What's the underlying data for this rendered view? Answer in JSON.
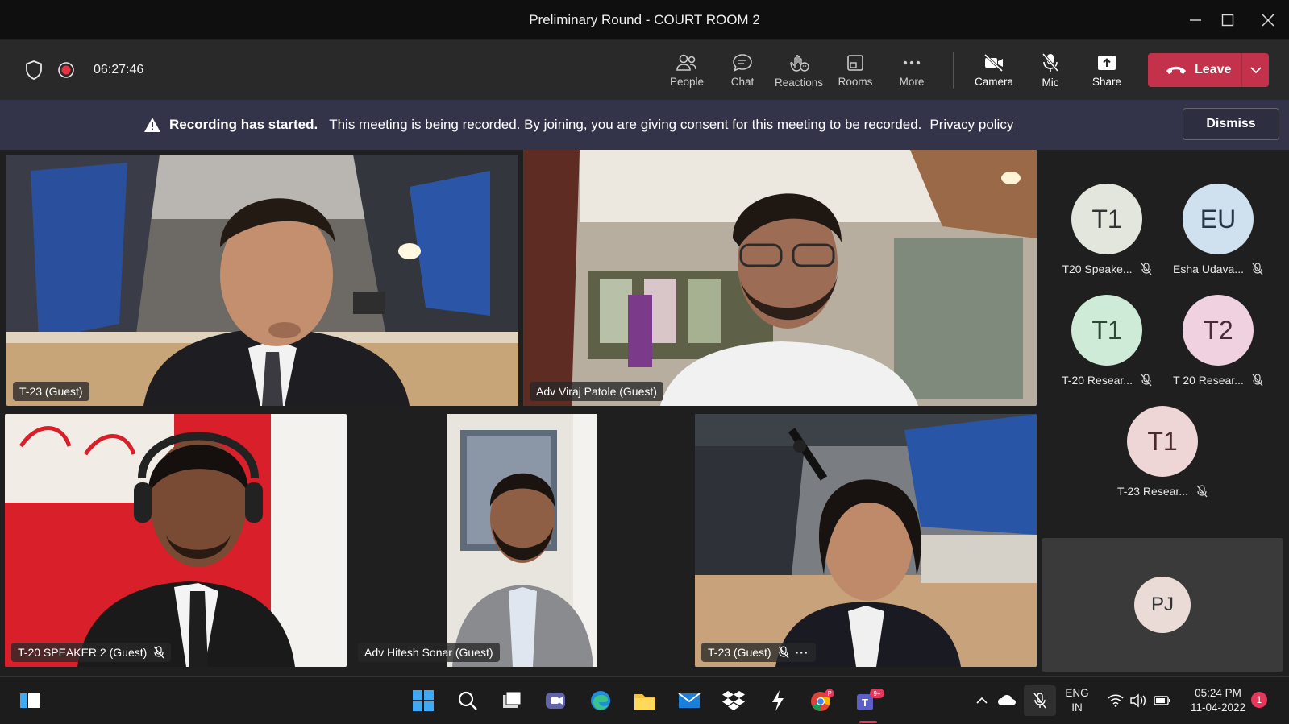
{
  "window": {
    "title": "Preliminary Round - COURT ROOM 2"
  },
  "toolbar": {
    "timer": "06:27:46",
    "buttons": {
      "people": "People",
      "chat": "Chat",
      "reactions": "Reactions",
      "rooms": "Rooms",
      "more": "More",
      "camera": "Camera",
      "mic": "Mic",
      "share": "Share"
    },
    "leave": "Leave"
  },
  "banner": {
    "headline": "Recording has started.",
    "message": "This meeting is being recorded. By joining, you are giving consent for this meeting to be recorded.",
    "link": "Privacy policy",
    "dismiss": "Dismiss"
  },
  "tiles": [
    {
      "name": "T-23 (Guest)",
      "muted": false,
      "active": true
    },
    {
      "name": "Adv Viraj Patole (Guest)",
      "muted": false
    },
    {
      "name": "T-20 SPEAKER 2 (Guest)",
      "muted": true
    },
    {
      "name": "Adv Hitesh Sonar (Guest)",
      "muted": false
    },
    {
      "name": "T-23 (Guest)",
      "muted": true,
      "more": "···"
    }
  ],
  "roster": [
    {
      "initials": "T1",
      "name": "T20 Speake...",
      "color": "#e2e6dc"
    },
    {
      "initials": "EU",
      "name": "Esha Udava...",
      "color": "#cfe0ef"
    },
    {
      "initials": "T1",
      "name": "T-20 Resear...",
      "color": "#cdebd7"
    },
    {
      "initials": "T2",
      "name": "T 20 Resear...",
      "color": "#efd1df"
    },
    {
      "initials": "T1",
      "name": "T-23 Resear...",
      "color": "#efd6d6"
    }
  ],
  "pj": {
    "initials": "PJ"
  },
  "taskbar": {
    "lang_top": "ENG",
    "lang_bottom": "IN",
    "time": "05:24 PM",
    "date": "11-04-2022",
    "notif_count": "1",
    "teams_badge": "9+",
    "chrome_badge": "P"
  },
  "colors": {
    "leave": "#c4314b",
    "banner": "#33344a",
    "active_outline": "#8b8cf3"
  }
}
